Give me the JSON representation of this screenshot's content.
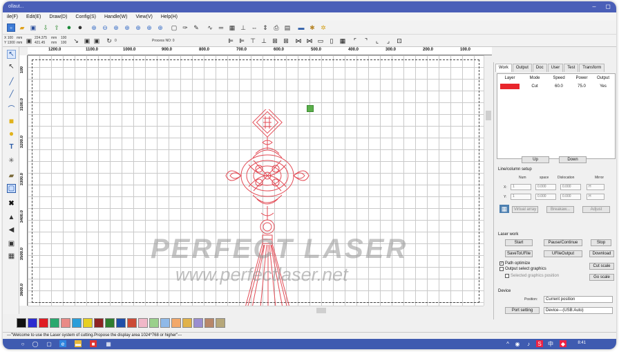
{
  "window": {
    "title": "ollaut...",
    "buttons": [
      "–",
      "◻"
    ]
  },
  "menu": [
    "ile(F)",
    "Edit(E)",
    "Draw(D)",
    "Config(S)",
    "Handle(W)",
    "View(V)",
    "Help(H)"
  ],
  "coords": {
    "x_label": "X",
    "x_value": "100",
    "x_unit": "mm",
    "y_label": "Y",
    "y_value": "1300",
    "y_unit": "mm",
    "w_value": "224.375",
    "w_unit": "mm",
    "h_value": "421.45",
    "h_unit": "mm",
    "sx_value": "100",
    "sy_value": "100",
    "rotate_value": "0",
    "process_no": "Process NO: 0"
  },
  "ruler_top": [
    "1200.0",
    "1100.0",
    "1000.0",
    "900.0",
    "800.0",
    "700.0",
    "600.0",
    "500.0",
    "400.0",
    "300.0",
    "200.0",
    "100.0"
  ],
  "ruler_left": [
    "100",
    "3100.0",
    "3200.0",
    "3300.0",
    "3400.0",
    "3500.0",
    "3600.0"
  ],
  "watermark": {
    "line1": "PERFECT LASER",
    "line2": "www.perfectlaser.net"
  },
  "right_panel": {
    "tabs": [
      "Work",
      "Output",
      "Doc",
      "User",
      "Test",
      "Transform"
    ],
    "layer_headers": [
      "Layer",
      "Mode",
      "Speed",
      "Power",
      "Output"
    ],
    "layers": [
      {
        "color": "#e8262c",
        "mode": "Cut",
        "speed": "60.0",
        "power": "75.0",
        "output": "Yes"
      }
    ],
    "up_label": "Up",
    "down_label": "Down",
    "array_title": "Line/column setup",
    "array_headers": [
      "Num",
      "space",
      "Dislocation",
      "Mirror"
    ],
    "row_x": {
      "label": "X:",
      "num": "1",
      "space": "0.000",
      "disloc": "0.000",
      "mirror": "H"
    },
    "row_y": {
      "label": "Y:",
      "num": "1",
      "space": "0.000",
      "disloc": "0.000",
      "mirror": "H"
    },
    "array_buttons": [
      "Virtual array",
      "Breakaw...",
      "Adjust"
    ],
    "laser_work_title": "Laser work",
    "start": "Start",
    "pause": "Pause/Continue",
    "stop": "Stop",
    "save_ufile": "SaveToUFile",
    "ufile_output": "UFileOutput",
    "download": "Download",
    "path_optimize": "Path optimize",
    "output_select": "Output select graphics",
    "selected_position": "Selected graphics position",
    "cut_scale": "Cut scale",
    "go_scale": "Go scale",
    "device_title": "Device",
    "position_label": "Position:",
    "position_value": "Current position",
    "port_setting": "Port setting",
    "device_value": "Device---(USB:Auto)"
  },
  "palette": [
    "#111111",
    "#2b2bd0",
    "#e01c24",
    "#29a86e",
    "#e98a86",
    "#2a9ed9",
    "#e6cf22",
    "#8e2222",
    "#2f7d2f",
    "#1f4fa8",
    "#cc4b36",
    "#f0b7c8",
    "#9ad08c",
    "#8fb9e8",
    "#f2a86a",
    "#e0b24a",
    "#9a8ed0",
    "#b8876a",
    "#b6a77a"
  ],
  "status": "---\"Welcome to use the Laser system of cutting.Propose the display area 1024*768 or higher\"---",
  "taskbar": {
    "clock": "8:41"
  },
  "colors": {
    "titlebar": "#4a5fb8",
    "taskbar": "#3f5bb0",
    "design": "#e34b55",
    "accent_green": "#5bb04b"
  }
}
